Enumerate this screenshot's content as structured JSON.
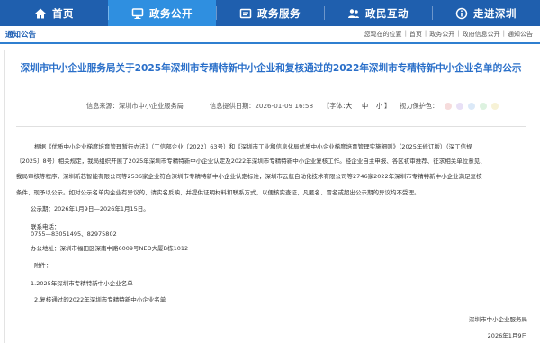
{
  "nav": {
    "items": [
      {
        "label": "首页",
        "icon": "home-icon"
      },
      {
        "label": "政务公开",
        "icon": "monitor-icon"
      },
      {
        "label": "政务服务",
        "icon": "service-icon"
      },
      {
        "label": "政民互动",
        "icon": "people-icon"
      },
      {
        "label": "走进深圳",
        "icon": "info-icon"
      }
    ],
    "active_index": 1
  },
  "breadcrumb": {
    "section": "通知公告",
    "prefix": "您现在的位置",
    "items": [
      "首页",
      "政务公开",
      "政府信息公开",
      "通知公告"
    ]
  },
  "article": {
    "title": "深圳市中小企业服务局关于2025年深圳市专精特新中小企业和复核通过的2022年深圳市专精特新中小企业名单的公示",
    "meta": {
      "source_label": "信息来源：深圳市中小企业服务局",
      "date_label": "信息提供日期：2026-01-09 16:58",
      "font_label": "【字体：",
      "font_large": "大",
      "font_mid": "中",
      "font_small": "小",
      "font_end": "】",
      "vision_label": "视力保护色：",
      "swatches": [
        "#f6dcdc",
        "#e8e0f6",
        "#dbe9f8",
        "#ddf2e0",
        "#f7f2d6"
      ]
    },
    "paragraphs": [
      "根据《优质中小企业梯度培育管理暂行办法》（工信部企业〔2022〕63号）和《深圳市工业和信息化局优质中小企业梯度培育管理实施细则》（2025年修订版）（深工信规",
      "〔2025〕8号）相关规定，我局组织开展了2025年深圳市专精特新中小企业认定及2022年深圳市专精特新中小企业复核工作。经企业自主申报、各区初审推荐、征求相关单位意见、",
      "我局审核等程序，深圳新芯智能有限公司等2536家企业符合深圳市专精特新中小企业认定标准，深圳市云航自动化技术有限公司等2746家2022年深圳市专精特新中小企业满足复核",
      "条件，现予以公示。如对公示名单内企业有异议的，请实名反映，并提供证明材料和联系方式，以便核实查证，凡匿名、冒名或超出公示期的异议均不受理。"
    ],
    "period_label": "公示期：",
    "period_value": "2026年1月9日—2026年1月15日。",
    "phone_label": "联系电话：",
    "phone_value": "0755—83051495、82975802",
    "address_label": "办公地址：",
    "address_value": "深圳市福田区深南中路6009号NEO大厦B栋1012",
    "attachments_label": "附件：",
    "attachments": [
      "1.2025年深圳市专精特新中小企业名单",
      "2.复核通过的2022年深圳市专精特新中小企业名单"
    ],
    "signature": "深圳市中小企业服务局",
    "sign_date": "2026年1月9日"
  }
}
